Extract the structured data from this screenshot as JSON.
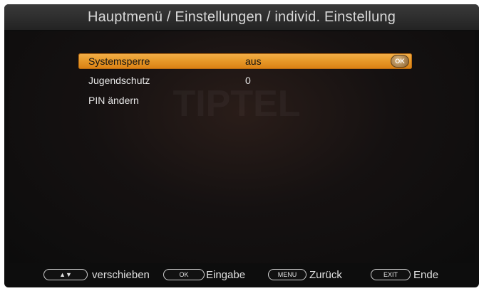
{
  "header": {
    "title": "Hauptmenü / Einstellungen / individ. Einstellung"
  },
  "watermark": "TIPTEL",
  "menu": {
    "items": [
      {
        "label": "Systemsperre",
        "value": "aus",
        "selected": true,
        "ok_badge": "OK"
      },
      {
        "label": "Jugendschutz",
        "value": "0",
        "selected": false
      },
      {
        "label": "PIN ändern",
        "value": "",
        "selected": false
      }
    ]
  },
  "footer": {
    "nav_key": "▲▼",
    "nav_label": "verschieben",
    "ok_key": "OK",
    "ok_label": "Eingabe",
    "menu_key": "MENU",
    "menu_label": "Zurück",
    "exit_key": "EXIT",
    "exit_label": "Ende"
  },
  "colors": {
    "highlight": "#e89a2a",
    "background": "#0d0d0d",
    "title_bar": "#2e2e2e",
    "text": "#e6e6e6"
  }
}
